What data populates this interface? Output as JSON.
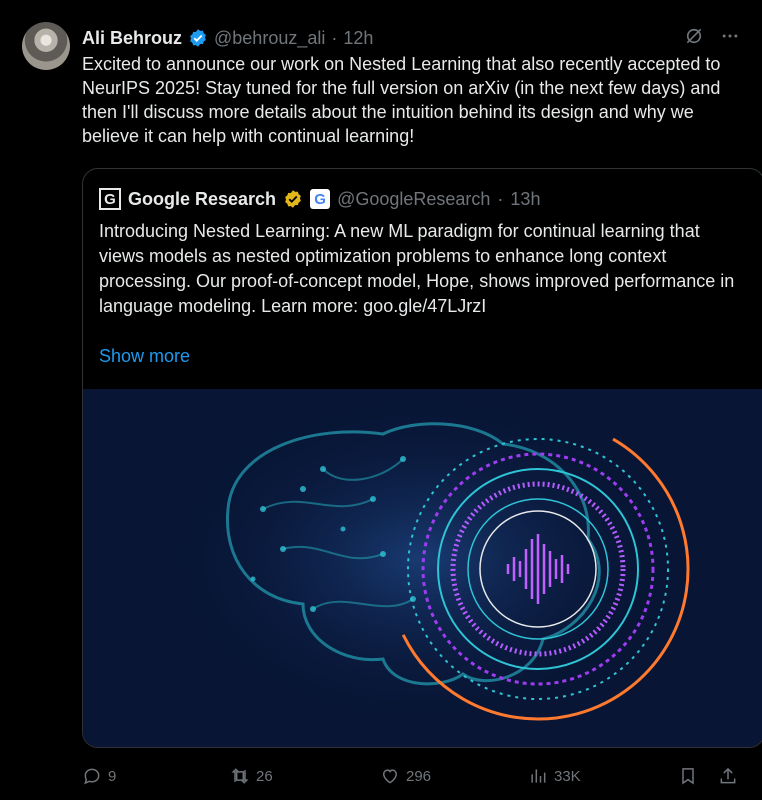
{
  "tweet": {
    "author_name": "Ali Behrouz",
    "handle": "@behrouz_ali",
    "separator": "·",
    "time": "12h",
    "text": "Excited to announce our work on Nested Learning that also recently accepted to NeurIPS 2025! Stay tuned for the full version on arXiv (in the next few days) and then I'll discuss more details about the intuition behind its design and why we believe it can help with continual learning!"
  },
  "quote": {
    "logo_letter": "G",
    "author_name": "Google Research",
    "badge_letter": "G",
    "handle": "@GoogleResearch",
    "separator": "·",
    "time": "13h",
    "text": "Introducing Nested Learning: A new ML paradigm for continual learning that views models as nested optimization problems to enhance long context processing. Our proof-of-concept model, Hope, shows improved performance in language modeling. Learn more: goo.gle/47LJrzI",
    "show_more": "Show more"
  },
  "actions": {
    "replies": "9",
    "reposts": "26",
    "likes": "296",
    "views": "33K"
  },
  "icons": {
    "verified": "verified-badge-icon",
    "grok": "grok-icon",
    "more": "more-icon",
    "reply": "reply-icon",
    "repost": "repost-icon",
    "like": "like-icon",
    "views": "views-icon",
    "bookmark": "bookmark-icon",
    "share": "share-icon"
  },
  "colors": {
    "background": "#000000",
    "accent": "#1d9bf0",
    "muted": "#71767b",
    "gold": "#e2b719",
    "media_bg": "#081535"
  }
}
